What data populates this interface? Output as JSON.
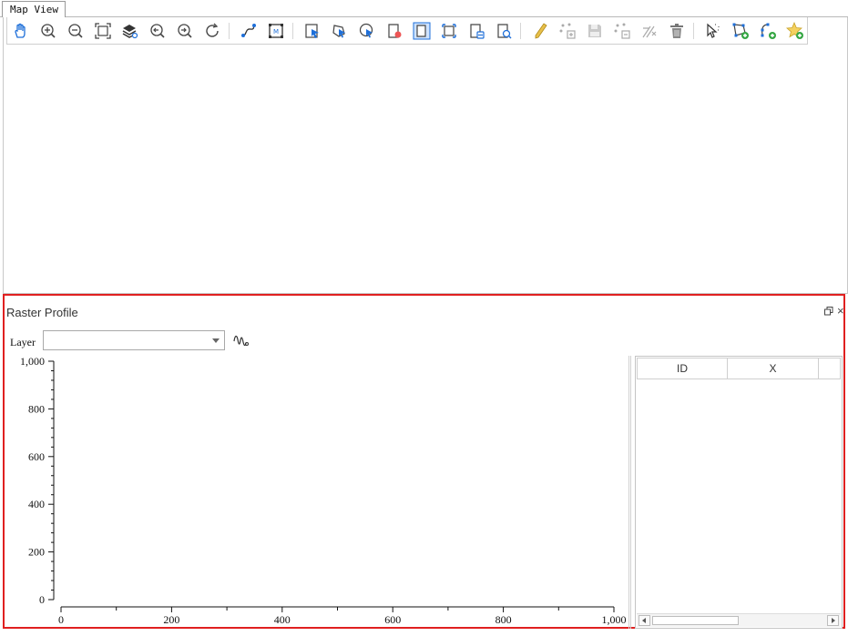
{
  "tabs": [
    {
      "label": "Map View"
    }
  ],
  "toolbar": {
    "groups": [
      [
        "pan-icon",
        "zoom-in-icon",
        "zoom-out-icon",
        "full-extent-icon",
        "zoom-to-layer-icon",
        "zoom-previous-icon",
        "zoom-next-icon",
        "refresh-icon"
      ],
      [
        "measure-icon",
        "map-image-icon"
      ],
      [
        "select-features-icon",
        "select-by-rectangle-icon",
        "select-by-polygon-icon",
        "clear-selection-icon",
        "select-active-icon",
        "select-all-icon",
        "select-by-attribute-icon",
        "select-by-location-icon"
      ],
      [
        "edit-pencil-icon",
        "add-vertex-icon",
        "save-edits-icon",
        "delete-vertex-icon",
        "cut-icon",
        "delete-feature-icon"
      ],
      [
        "move-feature-icon",
        "add-polygon-icon",
        "add-polyline-icon",
        "add-point-icon"
      ]
    ]
  },
  "panel": {
    "title": "Raster Profile",
    "layer_label": "Layer",
    "layer_value": ""
  },
  "chart_data": {
    "type": "line",
    "title": "",
    "xlabel": "",
    "ylabel": "",
    "xlim": [
      0,
      1000
    ],
    "ylim": [
      0,
      1000
    ],
    "x_ticks": [
      "0",
      "200",
      "400",
      "600",
      "800",
      "1,000"
    ],
    "y_ticks": [
      "0",
      "200",
      "400",
      "600",
      "800",
      "1,000"
    ],
    "series": []
  },
  "table": {
    "columns": [
      "ID",
      "X",
      ""
    ],
    "rows": []
  },
  "colors": {
    "panel_border": "#e02020",
    "selection_blue": "#1e6fd9"
  }
}
